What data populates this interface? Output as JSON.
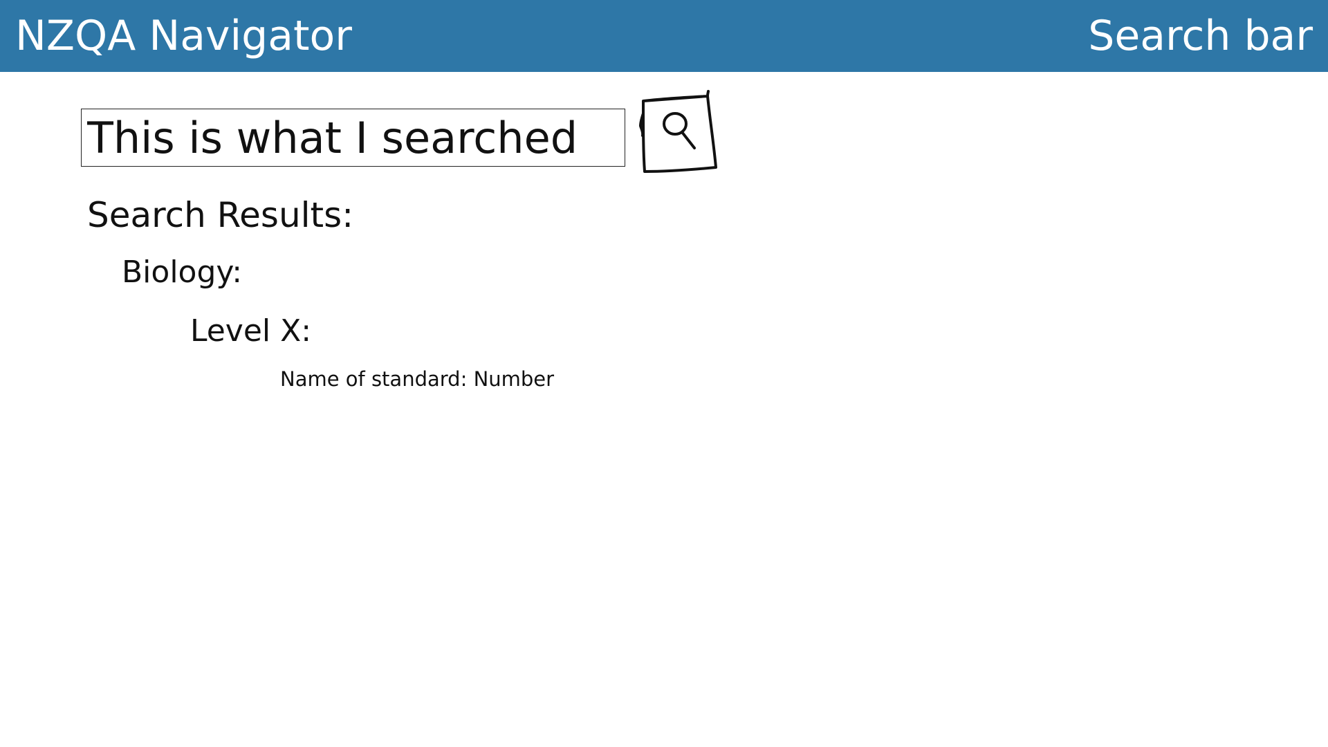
{
  "header": {
    "title": "NZQA Navigator",
    "right_label": "Search bar",
    "background_color": "#2e77a7",
    "text_color": "#ffffff"
  },
  "search": {
    "value": "This is what I searched",
    "button_icon": "magnifier-icon"
  },
  "results": {
    "heading": "Search Results:",
    "subject": "Biology:",
    "level": "Level X:",
    "standard": "Name of standard: Number"
  }
}
